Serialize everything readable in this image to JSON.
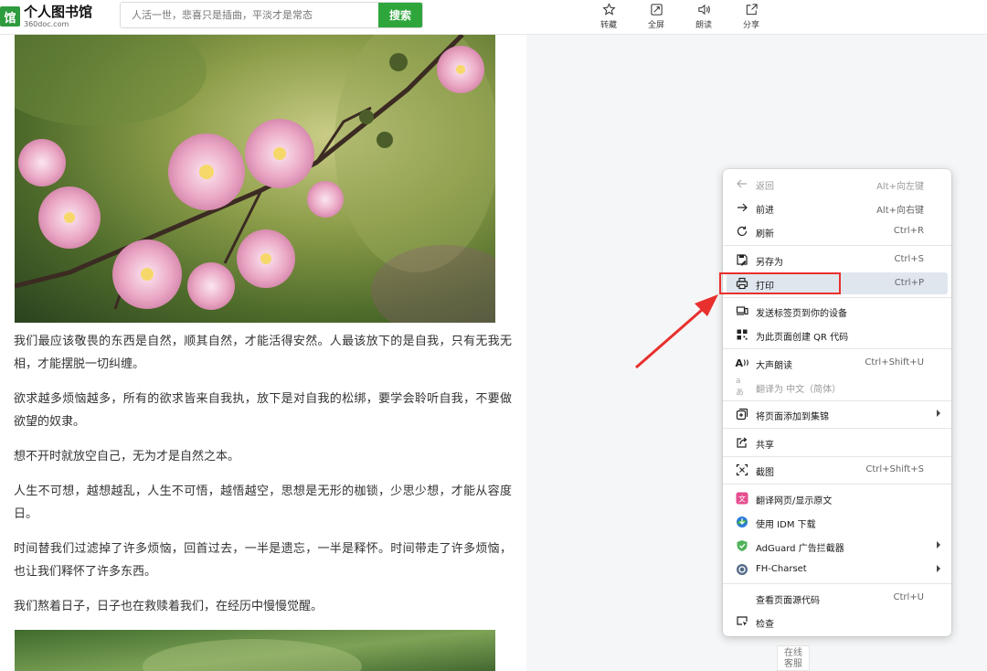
{
  "header": {
    "logo_mark": "馆",
    "logo_name": "个人图书馆",
    "logo_domain": "360doc.com",
    "search_placeholder": "人活一世，悲喜只是插曲，平淡才是常态",
    "search_button": "搜索",
    "tools": [
      {
        "label": "转藏",
        "icon": "star-icon"
      },
      {
        "label": "全屏",
        "icon": "fullscreen-icon"
      },
      {
        "label": "朗读",
        "icon": "speaker-icon"
      },
      {
        "label": "分享",
        "icon": "share-icon"
      }
    ]
  },
  "article": {
    "paragraphs": [
      "我们最应该敬畏的东西是自然，顺其自然，才能活得安然。人最该放下的是自我，只有无我无相，才能摆脱一切纠缠。",
      "欲求越多烦恼越多，所有的欲求皆来自我执，放下是对自我的松绑，要学会聆听自我，不要做欲望的奴隶。",
      "想不开时就放空自己，无为才是自然之本。",
      "人生不可想，越想越乱，人生不可悟，越悟越空，思想是无形的枷锁，少思少想，才能从容度日。",
      "时间替我们过滤掉了许多烦恼，回首过去，一半是遗忘，一半是释怀。时间带走了许多烦恼，也让我们释怀了许多东西。",
      "我们熬着日子，日子也在救赎着我们，在经历中慢慢觉醒。"
    ]
  },
  "service": {
    "line1": "在线",
    "line2": "客服"
  },
  "context_menu": {
    "items": [
      {
        "label": "返回",
        "shortcut": "Alt+向左键",
        "icon": "back-arrow-icon",
        "disabled": true
      },
      {
        "label": "前进",
        "shortcut": "Alt+向右键",
        "icon": "forward-arrow-icon"
      },
      {
        "label": "刷新",
        "shortcut": "Ctrl+R",
        "icon": "refresh-icon"
      },
      {
        "label": "另存为",
        "shortcut": "Ctrl+S",
        "icon": "save-as-icon"
      },
      {
        "label": "打印",
        "shortcut": "Ctrl+P",
        "icon": "printer-icon",
        "highlighted": true
      },
      {
        "label": "发送标签页到你的设备",
        "shortcut": "",
        "icon": "send-to-device-icon"
      },
      {
        "label": "为此页面创建 QR 代码",
        "shortcut": "",
        "icon": "qr-code-icon"
      },
      {
        "label": "大声朗读",
        "shortcut": "Ctrl+Shift+U",
        "icon": "read-aloud-icon"
      },
      {
        "label": "翻译为 中文（简体）",
        "shortcut": "",
        "icon": "translate-icon",
        "disabled": true
      },
      {
        "label": "将页面添加到集锦",
        "shortcut": "",
        "icon": "collections-icon",
        "submenu": true
      },
      {
        "label": "共享",
        "shortcut": "",
        "icon": "share-icon"
      },
      {
        "label": "截图",
        "shortcut": "Ctrl+Shift+S",
        "icon": "screenshot-icon"
      },
      {
        "label": "翻译网页/显示原文",
        "shortcut": "",
        "icon": "translate-ext-icon"
      },
      {
        "label": "使用 IDM 下载",
        "shortcut": "",
        "icon": "idm-icon"
      },
      {
        "label": "AdGuard 广告拦截器",
        "shortcut": "",
        "icon": "adguard-shield-icon",
        "submenu": true
      },
      {
        "label": "FH-Charset",
        "shortcut": "",
        "icon": "charset-icon",
        "submenu": true
      },
      {
        "label": "查看页面源代码",
        "shortcut": "Ctrl+U",
        "icon": "",
        "indent": true
      },
      {
        "label": "检查",
        "shortcut": "",
        "icon": "inspect-icon"
      }
    ]
  },
  "colors": {
    "brand_green": "#2ea63c",
    "highlight_border": "#e8302e",
    "menu_highlight": "#dfe6ee"
  }
}
